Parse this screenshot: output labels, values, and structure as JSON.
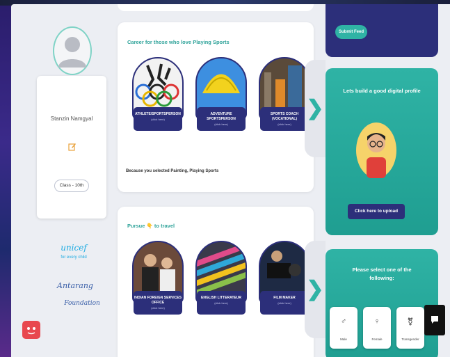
{
  "profile": {
    "name": "Stanzin Namgyal",
    "class_label": "Class - 10th"
  },
  "partners": {
    "unicef": "unicef",
    "unicef_tagline": "for every child",
    "partner_name": "Antarang",
    "partner_sub": "Foundation"
  },
  "top_right": {
    "submit_label": "Submit Feed"
  },
  "section_sports": {
    "title": "Career for those who love Playing Sports",
    "because": "Because you selected Painting, Playing Sports",
    "tiles": [
      {
        "label": "ATHLETE/SPORTSPERSON",
        "cta": "(click here)"
      },
      {
        "label": "ADVENTURE SPORTSPERSON",
        "cta": "(click here)"
      },
      {
        "label": "SPORTS COACH (VOCATIONAL)",
        "cta": "(click here)"
      }
    ]
  },
  "section_travel": {
    "title": "Pursue 👇 to travel",
    "tiles": [
      {
        "label": "INDIAN FOREIGN SERVICES OFFICE",
        "cta": "(click here)"
      },
      {
        "label": "ENGLISH LITTERATEUR",
        "cta": "(click here)"
      },
      {
        "label": "FILM MAKER",
        "cta": "(click here)"
      }
    ]
  },
  "digital_profile": {
    "title": "Lets build a good digital profile",
    "upload_label": "Click here to upload"
  },
  "gender_select": {
    "title": "Please select one of the following:",
    "options": [
      {
        "label": "Male",
        "icon": "male-icon"
      },
      {
        "label": "Female",
        "icon": "female-icon"
      },
      {
        "label": "Transgender",
        "icon": "transgender-icon"
      }
    ]
  },
  "colors": {
    "teal": "#2fb3a5",
    "navy": "#2c2f7a",
    "help_red": "#e8484f"
  }
}
